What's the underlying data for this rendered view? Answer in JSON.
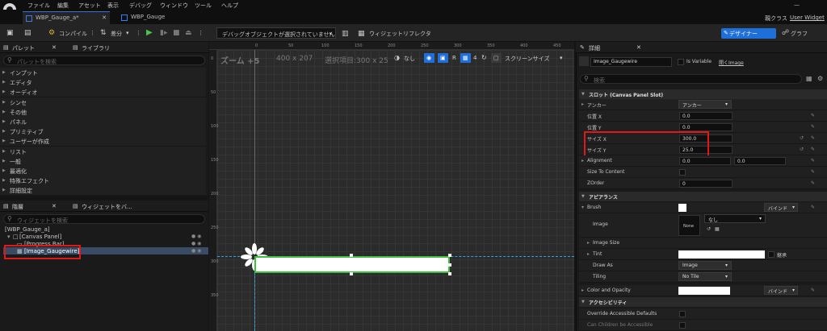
{
  "menu": [
    "ファイル",
    "編集",
    "アセット",
    "表示",
    "デバッグ",
    "ウィンドウ",
    "ツール",
    "ヘルプ"
  ],
  "tabs": [
    {
      "label": "WBP_Gauge_a*",
      "active": true
    },
    {
      "label": "WBP_Gauge",
      "active": false
    }
  ],
  "top_right": {
    "parent_class_label": "親クラス",
    "parent_class_value": "User Widget"
  },
  "toolbar": {
    "compile_label": "コンパイル",
    "diff_label": "差分",
    "debug_select": "デバッグオブジェクトが選択されていません",
    "reflector_label": "ウィジェットリフレクタ",
    "designer_label": "デザイナー",
    "graph_label": "グラフ"
  },
  "palette": {
    "tab_palette": "パレット",
    "tab_library": "ライブラリ",
    "search_placeholder": "パレットを検索",
    "categories": [
      "インプット",
      "エディタ",
      "オーディオ",
      "シンセ",
      "その他",
      "パネル",
      "プリミティブ",
      "ユーザーが作成",
      "リスト",
      "一般",
      "最適化",
      "特殊エフェクト",
      "詳細設定"
    ]
  },
  "hierarchy": {
    "tab_hierarchy": "階層",
    "tab_widget": "ウィジェットをバ...",
    "search_placeholder": "ウィジェットを検索",
    "items": [
      "[WBP_Gauge_a]",
      "[Canvas Panel]",
      "[Progress Bar]",
      "[Image_Gaugewire]"
    ]
  },
  "canvas": {
    "zoom": "ズーム +5",
    "resolution": "400 x 207",
    "selection": "選択項目:300 x 25",
    "none_label": "なし",
    "r_label": "R",
    "grid_value": "4",
    "screen_size": "スクリーンサイズ",
    "ruler_top": [
      "0",
      "50",
      "100",
      "150",
      "200",
      "250",
      "300",
      "350",
      "400",
      "450"
    ],
    "ruler_left": [
      "0",
      "50",
      "100",
      "150",
      "200",
      "250",
      "300",
      "350"
    ],
    "accent_color": "#3fbf3f"
  },
  "details": {
    "tab": "詳細",
    "name": "Image_Gaugewire",
    "is_variable": "Is Variable",
    "open_image": "開くImage",
    "search_placeholder": "検索",
    "slot_section": "スロット (Canvas Panel Slot)",
    "anchor_label": "アンカー",
    "anchor_value": "アンカー",
    "pos_x_label": "位置 X",
    "pos_x": "0.0",
    "pos_y_label": "位置 Y",
    "pos_y": "0.0",
    "size_x_label": "サイズ X",
    "size_x": "300.0",
    "size_y_label": "サイズ Y",
    "size_y": "25.0",
    "alignment_label": "Alignment",
    "alignment_x": "0.0",
    "alignment_y": "0.0",
    "size_to_content": "Size To Content",
    "zorder_label": "ZOrder",
    "zorder": "0",
    "appearance_section": "アピアランス",
    "brush_label": "Brush",
    "bind_label": "バインド",
    "image_label": "Image",
    "image_value": "なし",
    "thumb_label": "None",
    "image_size_label": "Image Size",
    "tint_label": "Tint",
    "tint_extra": "継承",
    "draw_as_label": "Draw As",
    "draw_as": "Image",
    "tiling_label": "Tiling",
    "tiling": "No Tile",
    "color_opacity_label": "Color and Opacity",
    "access_section": "アクセシビリティ",
    "override_label": "Override Accessible Defaults",
    "children_label": "Can Children be Accessible"
  }
}
